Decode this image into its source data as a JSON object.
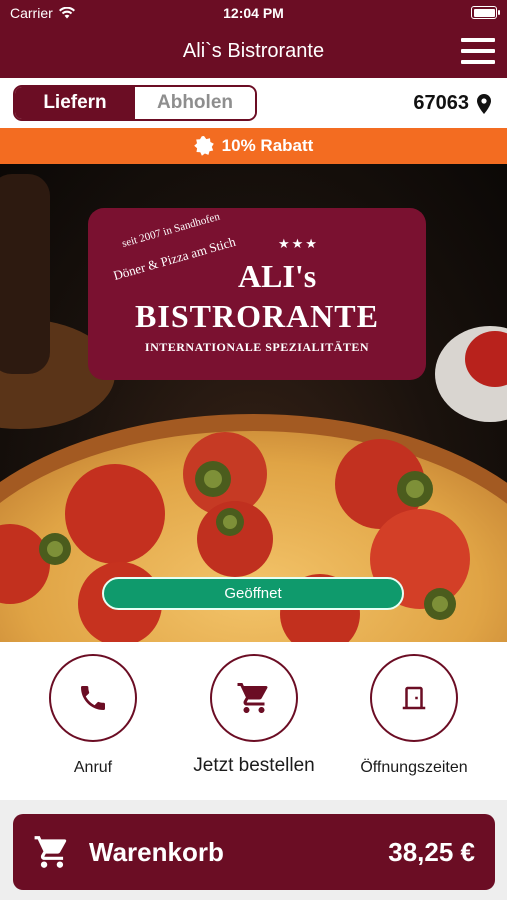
{
  "status_bar": {
    "carrier": "Carrier",
    "time": "12:04 PM"
  },
  "header": {
    "title": "Ali`s Bistrorante",
    "menu_icon": "hamburger-icon"
  },
  "order_mode": {
    "options": [
      "Liefern",
      "Abholen"
    ],
    "selected": "Liefern"
  },
  "location": {
    "zip": "67063",
    "icon": "location-pin-icon"
  },
  "discount": {
    "label": "10% Rabatt",
    "icon": "badge-icon"
  },
  "logo": {
    "since": "seit 2007 in Sandhofen",
    "arc_text": "Döner & Pizza am Stich",
    "name": "ALI's",
    "name_sub": "BISTRORANTE",
    "tagline": "INTERNATIONALE SPEZIALITÄTEN"
  },
  "status": {
    "label": "Geöffnet"
  },
  "actions": [
    {
      "label": "Anruf",
      "icon": "phone-icon"
    },
    {
      "label": "Jetzt bestellen",
      "icon": "cart-icon"
    },
    {
      "label": "Öffnungszeiten",
      "icon": "door-icon"
    }
  ],
  "cart": {
    "label": "Warenkorb",
    "total": "38,25 €",
    "icon": "cart-icon"
  },
  "colors": {
    "brand": "#6b0d24",
    "discount": "#f36c21",
    "open": "#0f9a6c"
  }
}
